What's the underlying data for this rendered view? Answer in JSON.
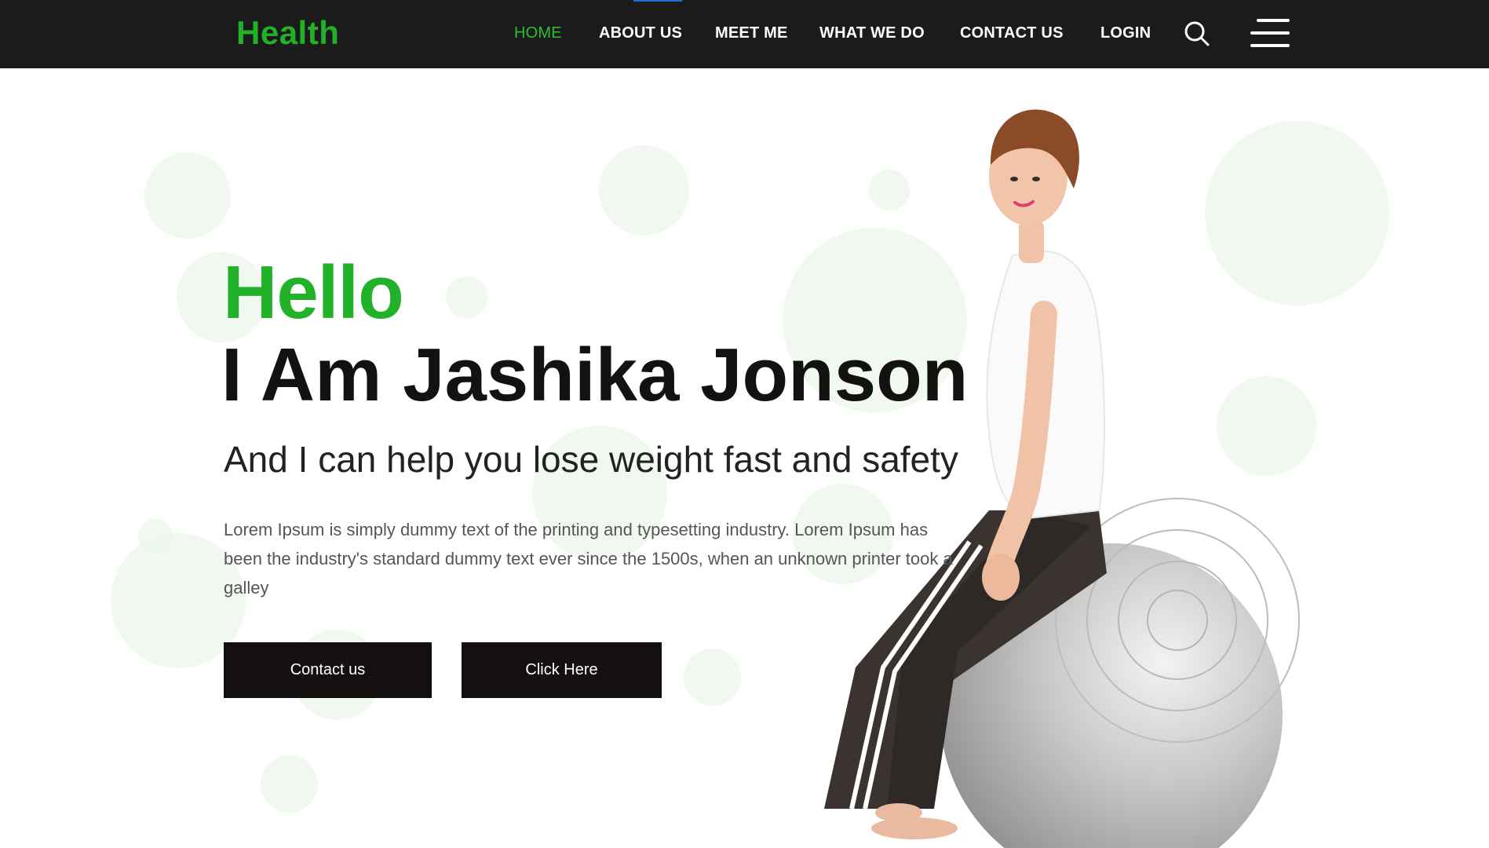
{
  "brand": {
    "logo_text": "Health",
    "accent_color": "#22b22a"
  },
  "nav": {
    "items": [
      {
        "label": "HOME",
        "active": true
      },
      {
        "label": "ABOUT US",
        "active": false
      },
      {
        "label": "MEET ME",
        "active": false
      },
      {
        "label": "WHAT WE DO",
        "active": false
      },
      {
        "label": "CONTACT US",
        "active": false
      },
      {
        "label": "LOGIN",
        "active": false
      }
    ],
    "search_icon": "search-icon",
    "menu_icon": "hamburger-menu-icon"
  },
  "hero": {
    "greeting": "Hello",
    "title": "I Am Jashika Jonson",
    "tagline": "And I can help you lose weight fast and safety",
    "description": "Lorem Ipsum is simply dummy text of the printing and typesetting industry. Lorem Ipsum has been the industry's standard dummy text ever since the 1500s, when an unknown printer took a galley",
    "buttons": {
      "contact": "Contact us",
      "click": "Click Here"
    }
  },
  "colors": {
    "header_bg": "#1b1b1b",
    "button_bg": "#141010",
    "bubble": "#edf7ec"
  }
}
